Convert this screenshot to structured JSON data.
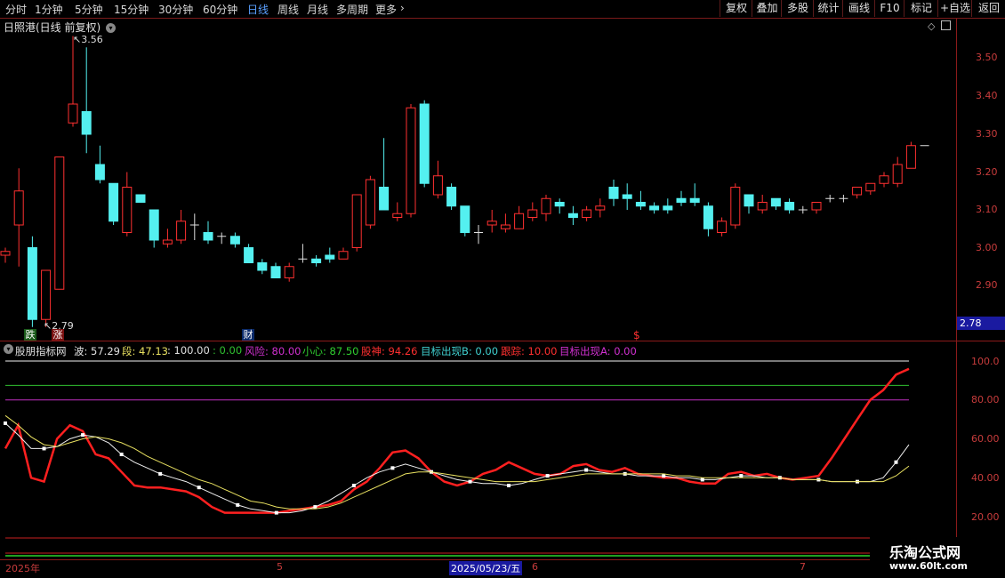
{
  "toolbar": {
    "periods": [
      "分时",
      "1分钟",
      "5分钟",
      "15分钟",
      "30分钟",
      "60分钟",
      "日线",
      "周线",
      "月线",
      "多周期",
      "更多"
    ],
    "active_period": "日线",
    "more_arrow": "›",
    "buttons": [
      "复权",
      "叠加",
      "多股",
      "统计",
      "画线",
      "F10",
      "标记",
      "+自选",
      "返回"
    ]
  },
  "main_chart": {
    "title": "日照港(日线 前复权)",
    "y_ticks": [
      "3.50",
      "3.40",
      "3.30",
      "3.20",
      "3.10",
      "3.00",
      "2.90"
    ],
    "current_price_label": "2.78",
    "high_label": "3.56",
    "low_label": "2.79",
    "markers": [
      {
        "text": "跌",
        "color": "#2a8a2a"
      },
      {
        "text": "涨",
        "color": "#c82020"
      },
      {
        "text": "财",
        "color": "#5aa0ff"
      },
      {
        "text": "$",
        "color": "#ff3030"
      }
    ],
    "colors": {
      "up": "#ff3030",
      "down": "#54f0f0",
      "axis": "#8b1a1a"
    }
  },
  "indicator": {
    "name": "股朋指标网",
    "items": [
      {
        "label": "波:",
        "value": "57.29",
        "color": "#e0e0e0"
      },
      {
        "label": "段:",
        "value": "47.13",
        "color": "#e8e060"
      },
      {
        "label": ":",
        "value": "100.00",
        "color": "#e0e0e0"
      },
      {
        "label": ":",
        "value": "0.00",
        "color": "#30c030"
      },
      {
        "label": "风险:",
        "value": "80.00",
        "color": "#d030d0"
      },
      {
        "label": "小心:",
        "value": "87.50",
        "color": "#30d030"
      },
      {
        "label": "股神:",
        "value": "94.26",
        "color": "#ff3030"
      },
      {
        "label": "目标出现B:",
        "value": "0.00",
        "color": "#40d0d0"
      },
      {
        "label": "跟踪:",
        "value": "10.00",
        "color": "#ff3030"
      },
      {
        "label": "目标出现A:",
        "value": "0.00",
        "color": "#d030d0"
      }
    ],
    "y_ticks": [
      "100.0",
      "80.00",
      "60.00",
      "40.00",
      "20.00"
    ]
  },
  "chart_data": {
    "type": "candlestick",
    "title": "日照港(日线 前复权)",
    "ylim": [
      2.78,
      3.62
    ],
    "ohlc": [
      [
        2.98,
        3.0,
        2.96,
        2.99
      ],
      [
        3.06,
        3.21,
        2.95,
        3.15
      ],
      [
        3.0,
        3.03,
        2.79,
        2.81
      ],
      [
        2.81,
        2.94,
        2.79,
        2.94
      ],
      [
        2.89,
        3.24,
        2.89,
        3.24
      ],
      [
        3.33,
        3.56,
        3.32,
        3.38
      ],
      [
        3.36,
        3.53,
        3.25,
        3.3
      ],
      [
        3.22,
        3.27,
        3.17,
        3.18
      ],
      [
        3.17,
        3.17,
        3.06,
        3.07
      ],
      [
        3.04,
        3.2,
        3.03,
        3.16
      ],
      [
        3.14,
        3.14,
        3.12,
        3.12
      ],
      [
        3.1,
        3.1,
        3.0,
        3.02
      ],
      [
        3.01,
        3.05,
        3.0,
        3.02
      ],
      [
        3.02,
        3.1,
        3.01,
        3.07
      ],
      [
        3.06,
        3.09,
        3.02,
        3.06
      ],
      [
        3.04,
        3.07,
        3.01,
        3.02
      ],
      [
        3.03,
        3.04,
        3.01,
        3.03
      ],
      [
        3.03,
        3.04,
        3.0,
        3.01
      ],
      [
        3.0,
        3.01,
        2.96,
        2.96
      ],
      [
        2.96,
        2.97,
        2.93,
        2.94
      ],
      [
        2.95,
        2.96,
        2.92,
        2.92
      ],
      [
        2.92,
        2.96,
        2.91,
        2.95
      ],
      [
        2.97,
        3.01,
        2.96,
        2.97
      ],
      [
        2.97,
        2.98,
        2.95,
        2.96
      ],
      [
        2.98,
        3.0,
        2.96,
        2.97
      ],
      [
        2.97,
        3.0,
        2.97,
        2.99
      ],
      [
        3.0,
        3.14,
        2.99,
        3.14
      ],
      [
        3.06,
        3.19,
        3.05,
        3.18
      ],
      [
        3.16,
        3.29,
        3.1,
        3.1
      ],
      [
        3.08,
        3.12,
        3.07,
        3.09
      ],
      [
        3.09,
        3.38,
        3.08,
        3.37
      ],
      [
        3.38,
        3.39,
        3.16,
        3.17
      ],
      [
        3.14,
        3.23,
        3.13,
        3.19
      ],
      [
        3.16,
        3.17,
        3.1,
        3.11
      ],
      [
        3.11,
        3.11,
        3.03,
        3.04
      ],
      [
        3.04,
        3.06,
        3.01,
        3.04
      ],
      [
        3.06,
        3.1,
        3.04,
        3.07
      ],
      [
        3.05,
        3.09,
        3.04,
        3.06
      ],
      [
        3.05,
        3.11,
        3.05,
        3.09
      ],
      [
        3.08,
        3.12,
        3.07,
        3.1
      ],
      [
        3.09,
        3.14,
        3.07,
        3.13
      ],
      [
        3.12,
        3.13,
        3.09,
        3.11
      ],
      [
        3.09,
        3.11,
        3.06,
        3.08
      ],
      [
        3.08,
        3.11,
        3.07,
        3.1
      ],
      [
        3.1,
        3.13,
        3.08,
        3.11
      ],
      [
        3.16,
        3.18,
        3.11,
        3.13
      ],
      [
        3.14,
        3.17,
        3.1,
        3.13
      ],
      [
        3.12,
        3.15,
        3.1,
        3.11
      ],
      [
        3.11,
        3.12,
        3.09,
        3.1
      ],
      [
        3.11,
        3.13,
        3.09,
        3.1
      ],
      [
        3.13,
        3.15,
        3.11,
        3.12
      ],
      [
        3.13,
        3.17,
        3.11,
        3.12
      ],
      [
        3.11,
        3.12,
        3.03,
        3.05
      ],
      [
        3.04,
        3.08,
        3.03,
        3.07
      ],
      [
        3.06,
        3.17,
        3.05,
        3.16
      ],
      [
        3.14,
        3.14,
        3.09,
        3.11
      ],
      [
        3.1,
        3.14,
        3.09,
        3.12
      ],
      [
        3.13,
        3.13,
        3.1,
        3.11
      ],
      [
        3.12,
        3.13,
        3.09,
        3.1
      ],
      [
        3.1,
        3.11,
        3.09,
        3.1
      ],
      [
        3.1,
        3.12,
        3.09,
        3.12
      ],
      [
        3.13,
        3.14,
        3.12,
        3.13
      ],
      [
        3.13,
        3.14,
        3.12,
        3.13
      ],
      [
        3.14,
        3.16,
        3.13,
        3.16
      ],
      [
        3.15,
        3.17,
        3.14,
        3.17
      ],
      [
        3.17,
        3.2,
        3.16,
        3.19
      ],
      [
        3.17,
        3.24,
        3.16,
        3.22
      ],
      [
        3.21,
        3.28,
        3.21,
        3.27
      ],
      [
        3.27,
        3.27,
        3.27,
        3.27
      ]
    ],
    "oscillator": {
      "y_ticks": [
        100,
        80,
        60,
        40,
        20
      ],
      "ylim": [
        10,
        105
      ],
      "levels": [
        {
          "value": 100,
          "color": "#f0f0f0"
        },
        {
          "value": 87.5,
          "color": "#30c030"
        },
        {
          "value": 80,
          "color": "#c030c0"
        }
      ],
      "series": [
        {
          "color": "#ff2020",
          "values": [
            55,
            67,
            40,
            38,
            60,
            67,
            64,
            52,
            50,
            43,
            36,
            35,
            35,
            34,
            33,
            30,
            25,
            22,
            22,
            22,
            22,
            22,
            23,
            24,
            25,
            26,
            28,
            34,
            38,
            45,
            53,
            54,
            50,
            43,
            38,
            36,
            38,
            42,
            44,
            48,
            45,
            42,
            41,
            42,
            46,
            47,
            44,
            43,
            45,
            42,
            41,
            40,
            40,
            38,
            37,
            37,
            42,
            43,
            41,
            42,
            40,
            39,
            40,
            41,
            50,
            60,
            70,
            80,
            85,
            93,
            96
          ]
        },
        {
          "color": "#f0f0f0",
          "values": [
            68,
            62,
            55,
            55,
            56,
            60,
            62,
            61,
            58,
            52,
            48,
            45,
            42,
            40,
            38,
            35,
            32,
            29,
            26,
            24,
            23,
            22,
            22,
            23,
            25,
            28,
            32,
            36,
            40,
            43,
            45,
            47,
            45,
            43,
            41,
            39,
            38,
            37,
            37,
            36,
            37,
            39,
            41,
            42,
            43,
            44,
            43,
            42,
            42,
            41,
            41,
            41,
            40,
            40,
            39,
            39,
            40,
            41,
            41,
            40,
            40,
            39,
            39,
            39,
            38,
            38,
            38,
            38,
            40,
            48,
            57
          ]
        },
        {
          "color": "#e8e060",
          "values": [
            72,
            67,
            61,
            57,
            56,
            58,
            60,
            61,
            60,
            58,
            55,
            51,
            48,
            45,
            42,
            39,
            37,
            34,
            31,
            28,
            27,
            25,
            24,
            24,
            24,
            25,
            27,
            30,
            33,
            36,
            39,
            42,
            43,
            43,
            42,
            41,
            40,
            39,
            38,
            38,
            38,
            38,
            39,
            40,
            41,
            42,
            42,
            42,
            42,
            42,
            42,
            42,
            41,
            41,
            40,
            40,
            40,
            40,
            40,
            40,
            40,
            39,
            39,
            39,
            38,
            38,
            38,
            38,
            38,
            41,
            46
          ]
        }
      ]
    },
    "x_labels": [
      {
        "text": "2025年",
        "index": 0
      },
      {
        "text": "5",
        "index": 18
      },
      {
        "text": "2025/05/23/五",
        "index": 34,
        "highlight": true
      },
      {
        "text": "6",
        "index": 35
      },
      {
        "text": "7",
        "index": 57
      }
    ]
  }
}
